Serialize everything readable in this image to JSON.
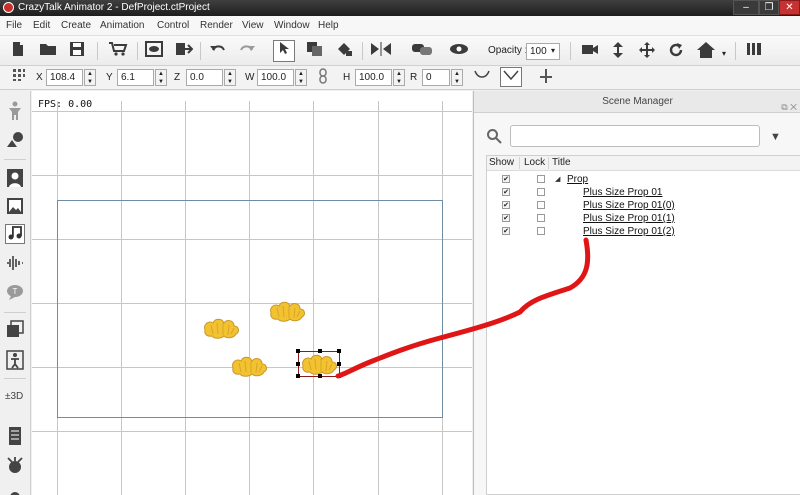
{
  "window": {
    "title": "CrazyTalk Animator 2  - DefProject.ctProject",
    "controls": {
      "minimize": "–",
      "restore": "❐",
      "close": "✕"
    }
  },
  "menu": [
    "File",
    "Edit",
    "Create",
    "Animation",
    "Control",
    "Render",
    "View",
    "Window",
    "Help"
  ],
  "toolbar": {
    "opacity_label": "Opacity :",
    "opacity_value": "100",
    "icons": [
      "new-file-icon",
      "open-folder-icon",
      "save-icon",
      "cart-icon",
      "preview-icon",
      "export-icon",
      "undo-icon",
      "redo-icon",
      "select-arrow-icon",
      "copy-icon",
      "fill-icon",
      "flip-icon",
      "link-icon",
      "eye-icon",
      "camera-icon",
      "move-vertical-icon",
      "move-icon",
      "rotate-icon",
      "home-icon",
      "timeline-icon"
    ]
  },
  "transform": {
    "x_label": "X",
    "x_value": "108.4",
    "y_label": "Y",
    "y_value": "6.1",
    "z_label": "Z",
    "z_value": "0.0",
    "w_label": "W",
    "w_value": "100.0",
    "h_label": "H",
    "h_value": "100.0",
    "r_label": "R",
    "r_value": "0"
  },
  "canvas": {
    "fps_label": "FPS: 0.00"
  },
  "scene_manager": {
    "title": "Scene Manager",
    "columns": {
      "show": "Show",
      "lock": "Lock",
      "title": "Title"
    },
    "rows": [
      {
        "title": "Prop",
        "show": true,
        "lock": false,
        "expanded": true,
        "level": 0
      },
      {
        "title": "Plus Size Prop 01",
        "show": true,
        "lock": false,
        "level": 1
      },
      {
        "title": "Plus Size Prop 01(0)",
        "show": true,
        "lock": false,
        "level": 1
      },
      {
        "title": "Plus Size Prop 01(1)",
        "show": true,
        "lock": false,
        "level": 1
      },
      {
        "title": "Plus Size Prop 01(2)",
        "show": true,
        "lock": false,
        "level": 1
      }
    ]
  },
  "colors": {
    "annotation": "#e01515",
    "prop": "#f2c230",
    "stage_frame": "#6f8ea5",
    "grid": "#c7c7c7"
  }
}
